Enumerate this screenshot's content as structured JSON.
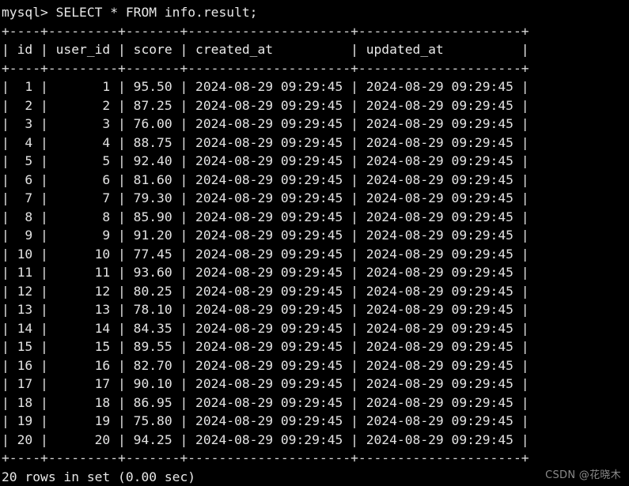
{
  "terminal": {
    "prompt": "mysql> ",
    "query": "SELECT * FROM info.result;",
    "prompt_line": "mysql> SELECT * FROM info.result;",
    "status_line": "20 rows in set (0.00 sec)",
    "row_count": 20,
    "elapsed": "0.00 sec",
    "background_color": "#000000",
    "text_color": "#e6e6e6"
  },
  "table": {
    "separator": "+----+---------+-------+---------------------+---------------------+",
    "header_line": "| id | user_id | score | created_at          | updated_at          |",
    "columns": [
      {
        "name": "id",
        "width": 2,
        "align": "right"
      },
      {
        "name": "user_id",
        "width": 7,
        "align": "right"
      },
      {
        "name": "score",
        "width": 5,
        "align": "right"
      },
      {
        "name": "created_at",
        "width": 19,
        "align": "left"
      },
      {
        "name": "updated_at",
        "width": 19,
        "align": "left"
      }
    ],
    "rows": [
      {
        "id": "1",
        "user_id": "1",
        "score": "95.50",
        "created_at": "2024-08-29 09:29:45",
        "updated_at": "2024-08-29 09:29:45"
      },
      {
        "id": "2",
        "user_id": "2",
        "score": "87.25",
        "created_at": "2024-08-29 09:29:45",
        "updated_at": "2024-08-29 09:29:45"
      },
      {
        "id": "3",
        "user_id": "3",
        "score": "76.00",
        "created_at": "2024-08-29 09:29:45",
        "updated_at": "2024-08-29 09:29:45"
      },
      {
        "id": "4",
        "user_id": "4",
        "score": "88.75",
        "created_at": "2024-08-29 09:29:45",
        "updated_at": "2024-08-29 09:29:45"
      },
      {
        "id": "5",
        "user_id": "5",
        "score": "92.40",
        "created_at": "2024-08-29 09:29:45",
        "updated_at": "2024-08-29 09:29:45"
      },
      {
        "id": "6",
        "user_id": "6",
        "score": "81.60",
        "created_at": "2024-08-29 09:29:45",
        "updated_at": "2024-08-29 09:29:45"
      },
      {
        "id": "7",
        "user_id": "7",
        "score": "79.30",
        "created_at": "2024-08-29 09:29:45",
        "updated_at": "2024-08-29 09:29:45"
      },
      {
        "id": "8",
        "user_id": "8",
        "score": "85.90",
        "created_at": "2024-08-29 09:29:45",
        "updated_at": "2024-08-29 09:29:45"
      },
      {
        "id": "9",
        "user_id": "9",
        "score": "91.20",
        "created_at": "2024-08-29 09:29:45",
        "updated_at": "2024-08-29 09:29:45"
      },
      {
        "id": "10",
        "user_id": "10",
        "score": "77.45",
        "created_at": "2024-08-29 09:29:45",
        "updated_at": "2024-08-29 09:29:45"
      },
      {
        "id": "11",
        "user_id": "11",
        "score": "93.60",
        "created_at": "2024-08-29 09:29:45",
        "updated_at": "2024-08-29 09:29:45"
      },
      {
        "id": "12",
        "user_id": "12",
        "score": "80.25",
        "created_at": "2024-08-29 09:29:45",
        "updated_at": "2024-08-29 09:29:45"
      },
      {
        "id": "13",
        "user_id": "13",
        "score": "78.10",
        "created_at": "2024-08-29 09:29:45",
        "updated_at": "2024-08-29 09:29:45"
      },
      {
        "id": "14",
        "user_id": "14",
        "score": "84.35",
        "created_at": "2024-08-29 09:29:45",
        "updated_at": "2024-08-29 09:29:45"
      },
      {
        "id": "15",
        "user_id": "15",
        "score": "89.55",
        "created_at": "2024-08-29 09:29:45",
        "updated_at": "2024-08-29 09:29:45"
      },
      {
        "id": "16",
        "user_id": "16",
        "score": "82.70",
        "created_at": "2024-08-29 09:29:45",
        "updated_at": "2024-08-29 09:29:45"
      },
      {
        "id": "17",
        "user_id": "17",
        "score": "90.10",
        "created_at": "2024-08-29 09:29:45",
        "updated_at": "2024-08-29 09:29:45"
      },
      {
        "id": "18",
        "user_id": "18",
        "score": "86.95",
        "created_at": "2024-08-29 09:29:45",
        "updated_at": "2024-08-29 09:29:45"
      },
      {
        "id": "19",
        "user_id": "19",
        "score": "75.80",
        "created_at": "2024-08-29 09:29:45",
        "updated_at": "2024-08-29 09:29:45"
      },
      {
        "id": "20",
        "user_id": "20",
        "score": "94.25",
        "created_at": "2024-08-29 09:29:45",
        "updated_at": "2024-08-29 09:29:45"
      }
    ]
  },
  "watermark": {
    "text": "CSDN @花晓木",
    "color": "#8a8a8a"
  }
}
